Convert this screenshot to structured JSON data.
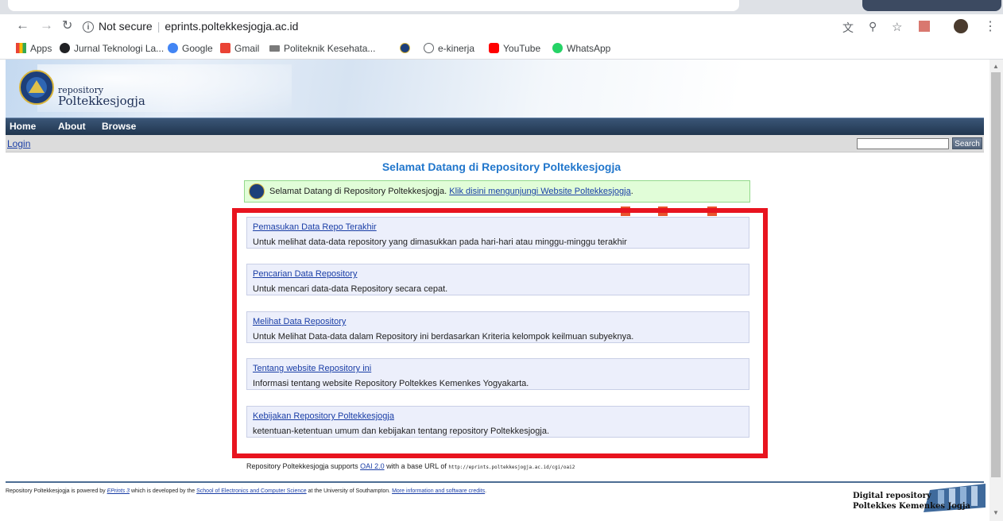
{
  "browser": {
    "url_prefix": "Not secure",
    "url": "eprints.poltekkesjogja.ac.id",
    "bookmarks": [
      "Apps",
      "Jurnal Teknologi La...",
      "Google",
      "Gmail",
      "Politeknik Kesehata...",
      "e-kinerja",
      "YouTube",
      "WhatsApp"
    ]
  },
  "site": {
    "logo_small": "repository",
    "logo_big": "Poltekkesjogja",
    "menu": [
      "Home",
      "About",
      "Browse"
    ],
    "login": "Login",
    "search_button": "Search",
    "search_value": ""
  },
  "main": {
    "title": "Selamat Datang di Repository Poltekkesjogja",
    "welcome_text": "Selamat Datang di Repository Poltekkesjogja.",
    "welcome_link": "Klik disini mengunjungi Website Poltekkesjogja",
    "cards": [
      {
        "link": "Pemasukan Data Repo Terakhir",
        "desc": "Untuk melihat data-data repository yang dimasukkan pada hari-hari atau minggu-minggu terakhir"
      },
      {
        "link": "Pencarian Data Repository",
        "desc": "Untuk mencari data-data Repository secara cepat."
      },
      {
        "link": "Melihat Data Repository",
        "desc": "Untuk Melihat Data-data dalam Repository ini berdasarkan Kriteria kelompok keilmuan subyeknya."
      },
      {
        "link": "Tentang website Repository ini",
        "desc": "Informasi tentang website Repository Poltekkes Kemenkes Yogyakarta."
      },
      {
        "link": "Kebijakan Repository Poltekkesjogja",
        "desc": "ketentuan-ketentuan umum dan kebijakan tentang repository Poltekkesjogja."
      }
    ],
    "oai_text1": "Repository Poltekkesjogja supports",
    "oai_link": "OAI 2.0",
    "oai_text2": "with a base URL of",
    "oai_url": "http://eprints.poltekkesjogja.ac.id/cgi/oai2"
  },
  "footer": {
    "t1": "Repository Poltekkesjogja is powered by",
    "l1": "EPrints 3",
    "t2": "which is developed by the",
    "l2": "School of Electronics and Computer Science",
    "t3": "at the University of Southampton.",
    "l3": "More information and software credits",
    "t4": ".",
    "dr1": "Digital repository",
    "dr2": "Poltekkes Kemenkes Jogja"
  },
  "colors": {
    "accent": "#2277cc",
    "highlight_frame": "#e8141f",
    "menu_bar": "#20364f"
  }
}
